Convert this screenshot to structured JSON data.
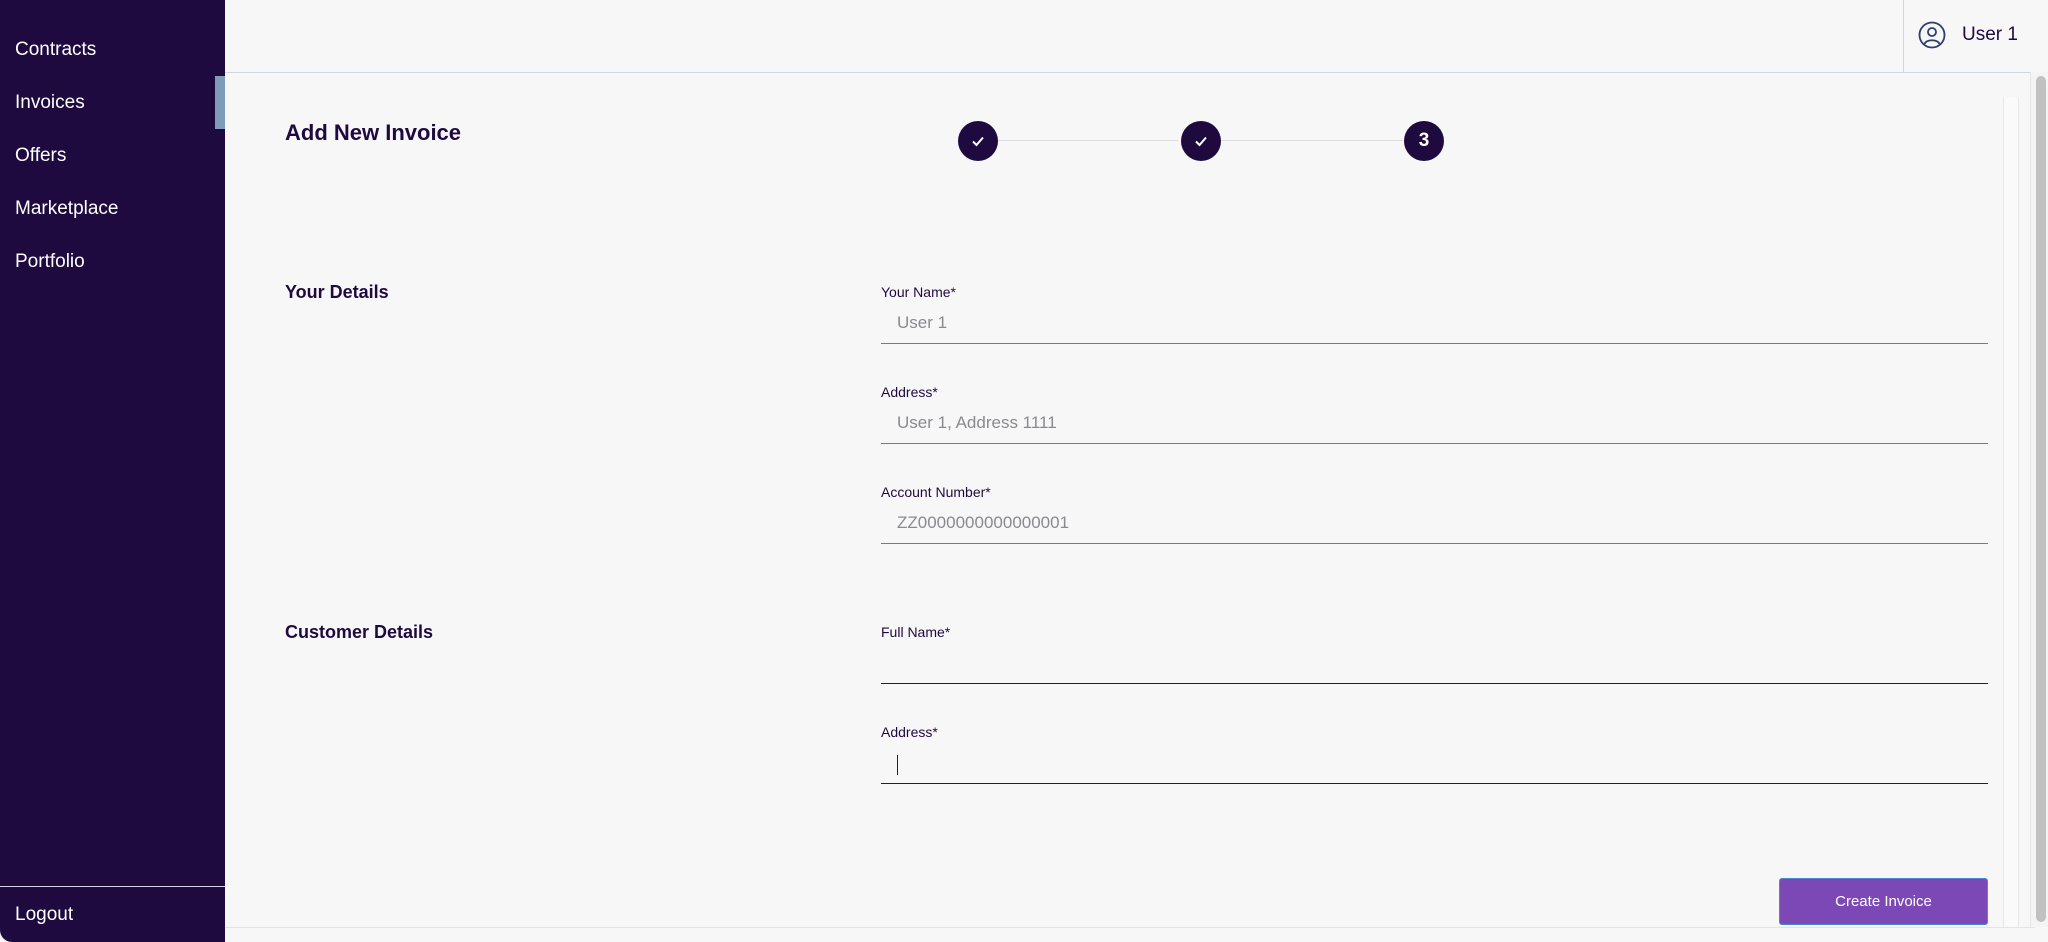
{
  "sidebar": {
    "items": [
      {
        "label": "Contracts",
        "active": false
      },
      {
        "label": "Invoices",
        "active": true
      },
      {
        "label": "Offers",
        "active": false
      },
      {
        "label": "Marketplace",
        "active": false
      },
      {
        "label": "Portfolio",
        "active": false
      }
    ],
    "logout_label": "Logout"
  },
  "header": {
    "user_icon": "user-circle-icon",
    "user_name": "User 1"
  },
  "page": {
    "title": "Add New Invoice",
    "stepper": {
      "steps": [
        {
          "state": "completed",
          "icon": "check-icon"
        },
        {
          "state": "completed",
          "icon": "check-icon"
        },
        {
          "state": "current",
          "label": "3"
        }
      ],
      "current_step": 3
    }
  },
  "your_details": {
    "title": "Your Details",
    "fields": [
      {
        "label": "Your Name*",
        "value": "User 1"
      },
      {
        "label": "Address*",
        "value": "User 1, Address 1111"
      },
      {
        "label": "Account Number*",
        "value": "ZZ0000000000000001"
      }
    ]
  },
  "customer_details": {
    "title": "Customer Details",
    "fields": [
      {
        "label": "Full Name*",
        "value": ""
      },
      {
        "label": "Address*",
        "value": ""
      }
    ]
  },
  "actions": {
    "create_label": "Create Invoice"
  },
  "colors": {
    "sidebar_bg": "#1f0a3f",
    "active_indicator": "#7c9cba",
    "primary_button": "#7b48b5",
    "background": "#f7f7f8"
  }
}
